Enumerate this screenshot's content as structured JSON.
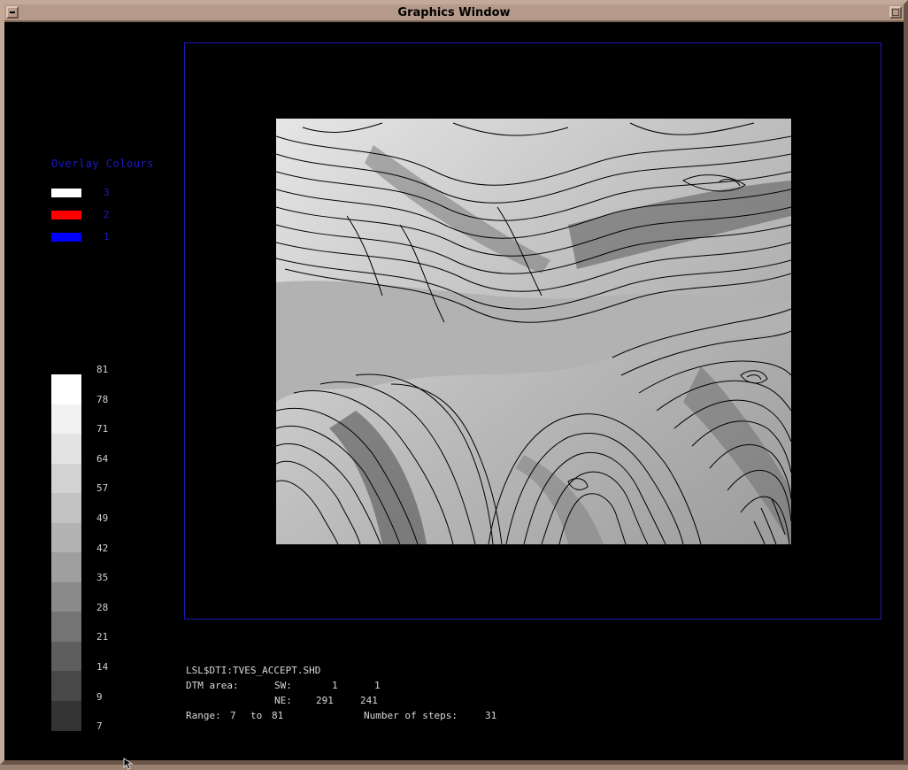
{
  "window": {
    "title": "Graphics Window"
  },
  "overlay": {
    "title": "Overlay Colours",
    "items": [
      {
        "label": "3",
        "color": "#ffffff"
      },
      {
        "label": "2",
        "color": "#ff0000"
      },
      {
        "label": "1",
        "color": "#0000ff"
      }
    ]
  },
  "scale": {
    "labels": [
      "81",
      "78",
      "71",
      "64",
      "57",
      "49",
      "42",
      "35",
      "28",
      "21",
      "14",
      "9",
      "7"
    ],
    "colors": [
      "#ffffff",
      "#f2f2f2",
      "#e3e3e3",
      "#d3d3d3",
      "#c3c3c3",
      "#b3b3b3",
      "#9f9f9f",
      "#8a8a8a",
      "#747474",
      "#5e5e5e",
      "#484848",
      "#343434",
      "#222222"
    ]
  },
  "info": {
    "file": "LSL$DTI:TVES_ACCEPT.SHD",
    "dtm_area_label": "DTM area:",
    "sw_label": "SW:",
    "sw_x": "1",
    "sw_y": "1",
    "ne_label": "NE:",
    "ne_x": "291",
    "ne_y": "241",
    "range_label": "Range:",
    "range_from": "7",
    "range_to_word": "to",
    "range_to": "81",
    "steps_label": "Number of steps:",
    "steps_value": "31"
  }
}
